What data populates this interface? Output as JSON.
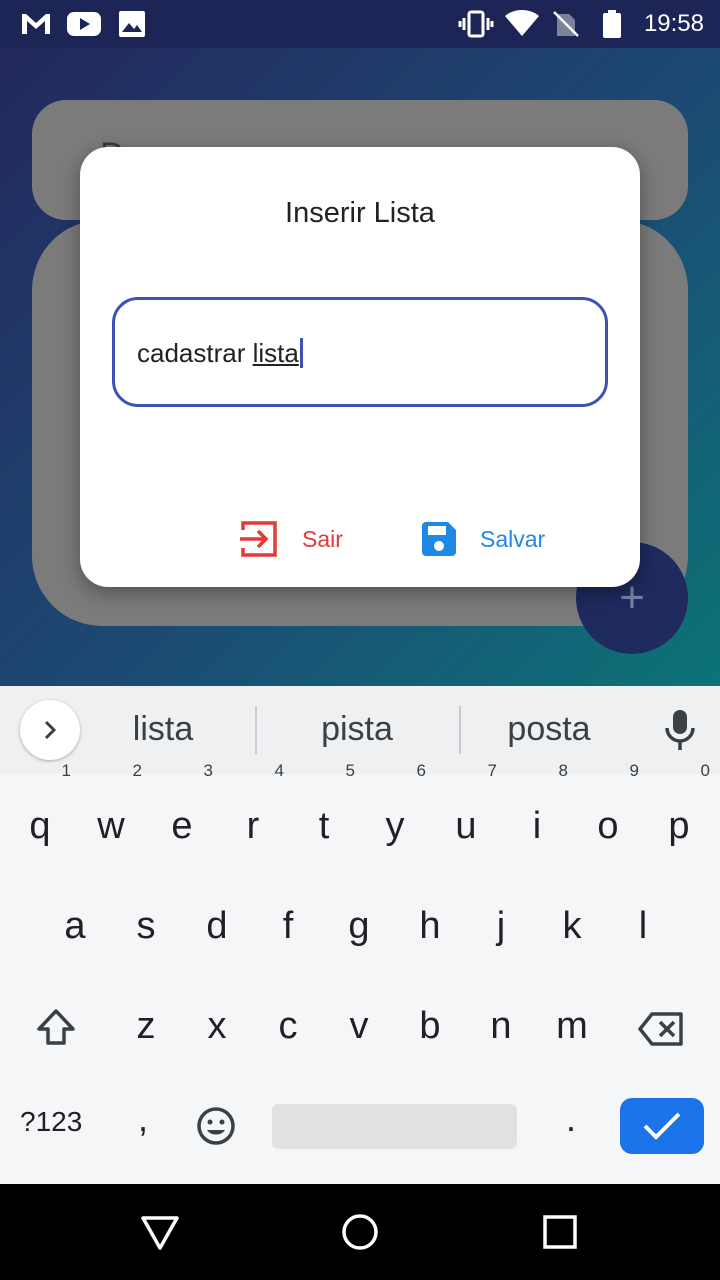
{
  "status_bar": {
    "time": "19:58",
    "left_icons": [
      "gmail-icon",
      "youtube-icon",
      "image-icon"
    ],
    "right_icons": [
      "vibrate-icon",
      "wifi-icon",
      "no-sim-icon",
      "battery-icon"
    ]
  },
  "background": {
    "peek_text": "D"
  },
  "dialog": {
    "title": "Inserir Lista",
    "input_value_prefix": "cadastrar ",
    "input_value_underlined": "lista",
    "cancel_label": "Sair",
    "save_label": "Salvar",
    "colors": {
      "cancel": "#e53935",
      "save": "#1e88e5",
      "field_border": "#3f51b5"
    }
  },
  "fab": {
    "label": "+"
  },
  "keyboard": {
    "suggestions": [
      "lista",
      "pista",
      "posta"
    ],
    "row1": [
      {
        "key": "q",
        "hint": "1"
      },
      {
        "key": "w",
        "hint": "2"
      },
      {
        "key": "e",
        "hint": "3"
      },
      {
        "key": "r",
        "hint": "4"
      },
      {
        "key": "t",
        "hint": "5"
      },
      {
        "key": "y",
        "hint": "6"
      },
      {
        "key": "u",
        "hint": "7"
      },
      {
        "key": "i",
        "hint": "8"
      },
      {
        "key": "o",
        "hint": "9"
      },
      {
        "key": "p",
        "hint": "0"
      }
    ],
    "row2": [
      "a",
      "s",
      "d",
      "f",
      "g",
      "h",
      "j",
      "k",
      "l"
    ],
    "row3": [
      "z",
      "x",
      "c",
      "v",
      "b",
      "n",
      "m"
    ],
    "symbols_label": "?123",
    "comma_label": ",",
    "period_label": "."
  }
}
